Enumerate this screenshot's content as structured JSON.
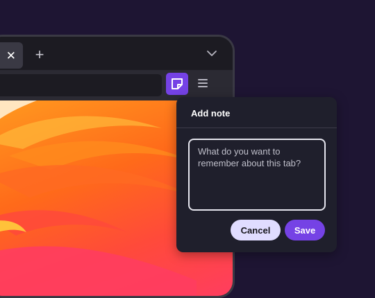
{
  "colors": {
    "page_bg": "#1e1533",
    "accent": "#7542e5",
    "toolbar": "#2b2a33",
    "popup_bg": "#1f1f2c"
  },
  "browser": {
    "tab": {
      "close_glyph": "✕"
    },
    "new_tab_glyph": "+",
    "icons": [
      "close-icon",
      "plus-icon",
      "chevron-down-icon",
      "sticky-note-icon",
      "hamburger-menu-icon"
    ]
  },
  "note_popup": {
    "title": "Add note",
    "placeholder": "What do you want to remember about this tab?",
    "cancel_label": "Cancel",
    "save_label": "Save"
  }
}
